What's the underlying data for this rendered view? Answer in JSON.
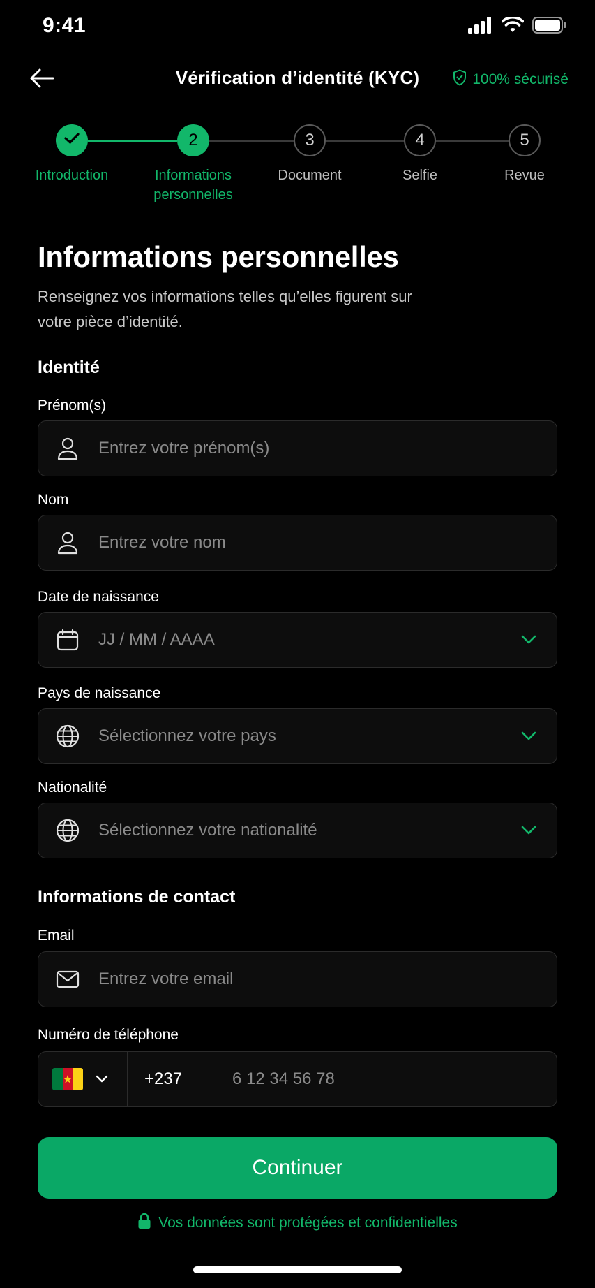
{
  "status_bar": {
    "time": "9:41"
  },
  "header": {
    "title": "Vérification d’identité (KYC)",
    "secure_label": "100% sécurisé"
  },
  "stepper": {
    "steps": [
      {
        "number": "1",
        "label": "Introduction",
        "state": "complete"
      },
      {
        "number": "2",
        "label": "Informations personnelles",
        "state": "current"
      },
      {
        "number": "3",
        "label": "Document",
        "state": "pending"
      },
      {
        "number": "4",
        "label": "Selfie",
        "state": "pending"
      },
      {
        "number": "5",
        "label": "Revue",
        "state": "pending"
      }
    ]
  },
  "page": {
    "title": "Informations personnelles",
    "subtitle": "Renseignez vos informations telles qu’elles figurent sur votre pièce d’identité."
  },
  "identity": {
    "section_title": "Identité",
    "first_name": {
      "label": "Prénom(s)",
      "placeholder": "Entrez votre prénom(s)"
    },
    "last_name": {
      "label": "Nom",
      "placeholder": "Entrez votre nom"
    },
    "birth_date": {
      "label": "Date de naissance",
      "placeholder": "JJ / MM / AAAA"
    },
    "birth_country": {
      "label": "Pays de naissance",
      "placeholder": "Sélectionnez votre pays"
    },
    "nationality": {
      "label": "Nationalité",
      "placeholder": "Sélectionnez votre nationalité"
    }
  },
  "contact": {
    "section_title": "Informations de contact",
    "email": {
      "label": "Email",
      "placeholder": "Entrez votre email"
    },
    "phone": {
      "label": "Numéro de téléphone",
      "dial_code": "+237",
      "placeholder": "6 12 34 56 78",
      "country_flag": "cameroon-flag"
    }
  },
  "actions": {
    "continue_label": "Continuer"
  },
  "footer": {
    "privacy_text": "Vos données sont protégées et confidentielles"
  },
  "colors": {
    "accent": "#12b76a",
    "button": "#0aa866",
    "background": "#000000",
    "field_bg": "#0d0d0d",
    "field_border": "#2b2b2b"
  }
}
